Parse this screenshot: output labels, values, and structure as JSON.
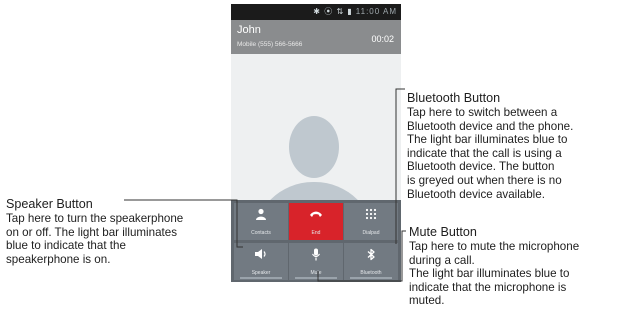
{
  "phone": {
    "status": {
      "icons": "✱ ⦿ ⇅ ▮",
      "time": "11:00 AM"
    },
    "caller": {
      "name": "John",
      "number": "Mobile (555) 566-5666",
      "timer": "00:02"
    },
    "buttons": [
      {
        "icon": "person-icon",
        "label": "Contacts"
      },
      {
        "icon": "hangup-icon",
        "label": "End"
      },
      {
        "icon": "dialpad-icon",
        "label": "Dialpad"
      },
      {
        "icon": "speaker-icon",
        "label": "Speaker"
      },
      {
        "icon": "mic-icon",
        "label": "Mute"
      },
      {
        "icon": "bluetooth-icon",
        "label": "Bluetooth"
      }
    ]
  },
  "callouts": {
    "speaker": {
      "title": "Speaker Button",
      "body": "Tap here to turn the speakerphone\non or off. The light bar illuminates\nblue to indicate that the\nspeakerphone is on."
    },
    "bluetooth": {
      "title": "Bluetooth Button",
      "body": "Tap here to switch between a\nBluetooth device and the phone.\nThe light bar illuminates blue to\nindicate that the call is using a\nBluetooth device. The button\nis greyed out when there is no\nBluetooth device available."
    },
    "mute": {
      "title": "Mute Button",
      "body": "Tap here to mute the microphone\nduring a call.\nThe light bar illuminates blue to\nindicate that the microphone is\nmuted."
    }
  },
  "colors": {
    "end_button": "#d8232a",
    "leader_line": "#333333",
    "caller_bar": "#8a8c8e"
  }
}
